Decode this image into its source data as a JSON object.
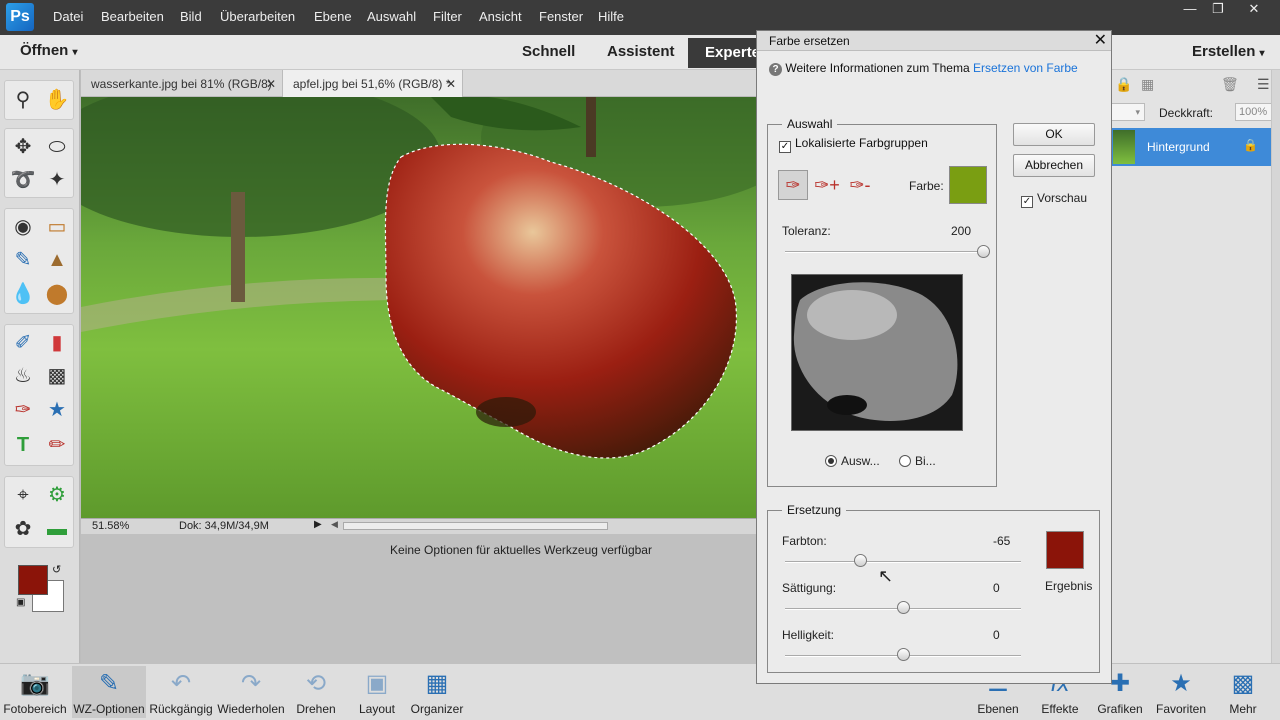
{
  "menu": {
    "logo": "PSE",
    "items": [
      "Datei",
      "Bearbeiten",
      "Bild",
      "Überarbeiten",
      "Ebene",
      "Auswahl",
      "Filter",
      "Ansicht",
      "Fenster",
      "Hilfe"
    ]
  },
  "modebar": {
    "open_label": "Öffnen",
    "quick": "Schnell",
    "guided": "Assistent",
    "expert": "Experte",
    "create": "Erstellen"
  },
  "tabs": [
    {
      "label": "wasserkante.jpg bei 81% (RGB/8)"
    },
    {
      "label": "apfel.jpg bei 51,6% (RGB/8) *"
    }
  ],
  "status": {
    "zoom": "51.58%",
    "doc": "Dok: 34,9M/34,9M"
  },
  "options_message": "Keine Optionen für aktuelles Werkzeug verfügbar",
  "colors": {
    "foreground": "#8b1409",
    "background": "#ffffff",
    "sample": "#7a9e12",
    "result": "#8b1409"
  },
  "layers": {
    "opacity_label": "Deckkraft:",
    "opacity_value": "100%",
    "layer_name": "Hintergrund"
  },
  "dialog": {
    "title": "Farbe ersetzen",
    "help_text": "Weitere Informationen zum Thema",
    "help_link": "Ersetzen von Farbe",
    "ok": "OK",
    "cancel": "Abbrechen",
    "preview": "Vorschau",
    "selection": {
      "legend": "Auswahl",
      "localized": "Lokalisierte Farbgruppen",
      "color_label": "Farbe:",
      "tolerance_label": "Toleranz:",
      "tolerance_value": "200",
      "tolerance_fraction": 1.0,
      "radio_selection": "Ausw...",
      "radio_image": "Bi..."
    },
    "replacement": {
      "legend": "Ersetzung",
      "hue_label": "Farbton:",
      "hue_value": "-65",
      "saturation_label": "Sättigung:",
      "saturation_value": "0",
      "lightness_label": "Helligkeit:",
      "lightness_value": "0",
      "result_label": "Ergebnis"
    }
  },
  "bottom": [
    {
      "label": "Fotobereich",
      "icon": "photo-bin-icon"
    },
    {
      "label": "WZ-Optionen",
      "icon": "tool-options-icon"
    },
    {
      "label": "Rückgängig",
      "icon": "undo-icon"
    },
    {
      "label": "Wiederholen",
      "icon": "redo-icon"
    },
    {
      "label": "Drehen",
      "icon": "rotate-icon"
    },
    {
      "label": "Layout",
      "icon": "layout-icon"
    },
    {
      "label": "Organizer",
      "icon": "organizer-icon"
    },
    {
      "label": "Ebenen",
      "icon": "layers-icon"
    },
    {
      "label": "Effekte",
      "icon": "effects-icon"
    },
    {
      "label": "Grafiken",
      "icon": "graphics-icon"
    },
    {
      "label": "Favoriten",
      "icon": "favorites-icon"
    },
    {
      "label": "Mehr",
      "icon": "more-icon"
    }
  ]
}
